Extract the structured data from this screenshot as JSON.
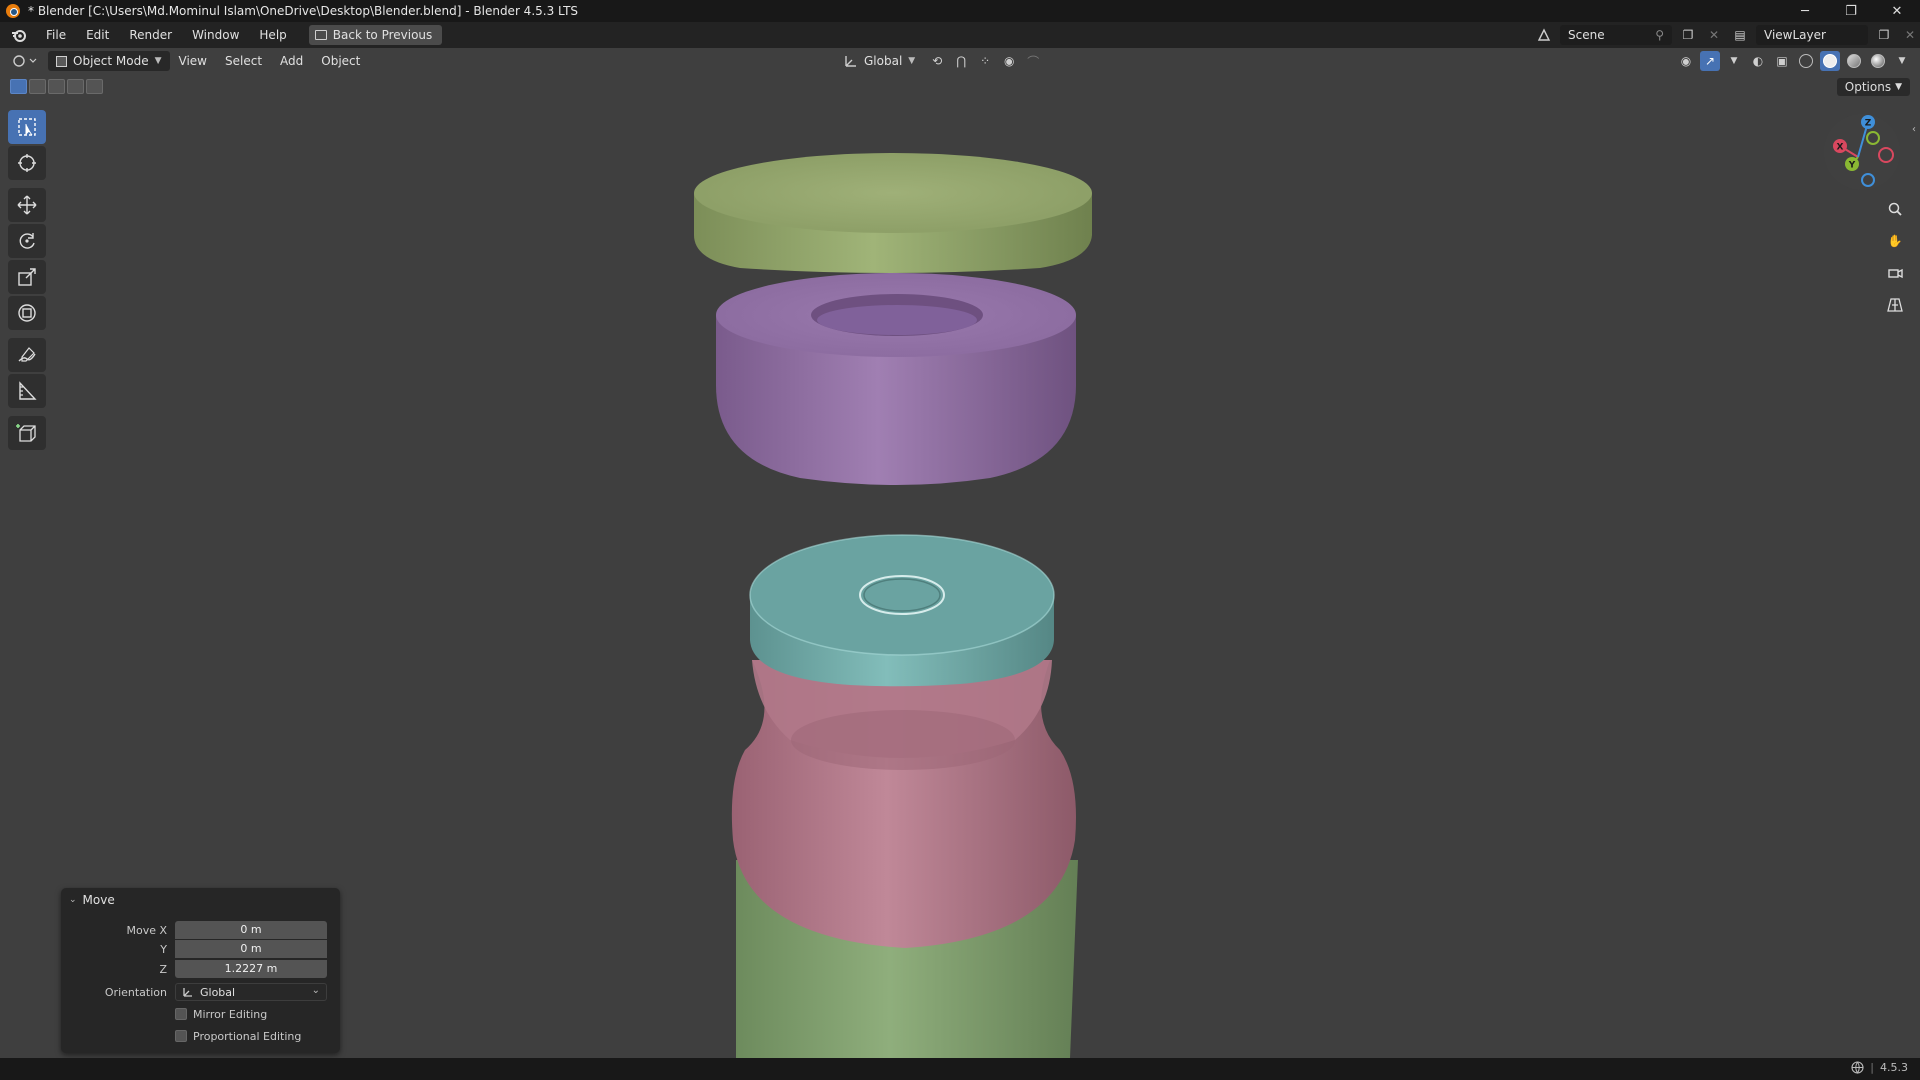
{
  "window": {
    "title": "* Blender [C:\\Users\\Md.Mominul Islam\\OneDrive\\Desktop\\Blender.blend] - Blender 4.5.3 LTS",
    "minimize": "─",
    "maximize": "❐",
    "close": "✕"
  },
  "menu": {
    "items": [
      "File",
      "Edit",
      "Render",
      "Window",
      "Help"
    ],
    "back_button": "Back to Previous",
    "scene": "Scene",
    "view_layer": "ViewLayer"
  },
  "viewport_header": {
    "mode": "Object Mode",
    "menus": [
      "View",
      "Select",
      "Add",
      "Object"
    ],
    "transform_orientation": "Global",
    "options_label": "Options"
  },
  "gizmo": {
    "x": "X",
    "y": "Y",
    "z": "Z",
    "colors": {
      "x": "#d9485f",
      "y": "#8ab833",
      "z": "#3f8fd9"
    }
  },
  "operator_panel": {
    "title": "Move",
    "move_x_label": "Move X",
    "move_x": "0 m",
    "y_label": "Y",
    "y": "0 m",
    "z_label": "Z",
    "z": "1.2227 m",
    "orientation_label": "Orientation",
    "orientation": "Global",
    "mirror_editing": "Mirror Editing",
    "proportional_editing": "Proportional Editing"
  },
  "status": {
    "version": "4.5.3"
  },
  "colors": {
    "accent": "#4772b3",
    "cap_top": "#8ea06a",
    "ring": "#8b6a9c",
    "lid": "#6aa3a1",
    "neck": "#b07686",
    "body": "#7f9e6e"
  }
}
